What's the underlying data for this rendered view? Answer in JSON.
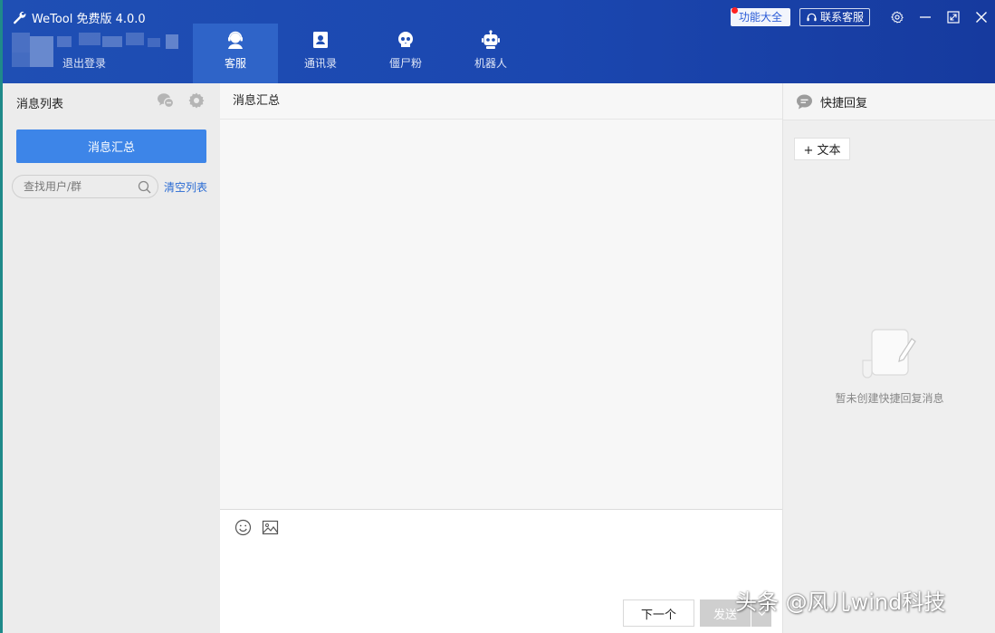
{
  "app": {
    "title": "WeTool 免费版 4.0.0",
    "logout_label": "退出登录"
  },
  "nav": {
    "items": [
      {
        "label": "客服",
        "icon": "customer-service-icon",
        "active": true
      },
      {
        "label": "通讯录",
        "icon": "contacts-icon",
        "active": false
      },
      {
        "label": "僵尸粉",
        "icon": "skull-icon",
        "active": false
      },
      {
        "label": "机器人",
        "icon": "robot-icon",
        "active": false
      }
    ]
  },
  "top_right": {
    "features_label": "功能大全",
    "support_label": "联系客服"
  },
  "left_panel": {
    "title": "消息列表",
    "summary_button": "消息汇总",
    "search_placeholder": "查找用户/群",
    "clear_list": "清空列表"
  },
  "middle_panel": {
    "title": "消息汇总",
    "next_button": "下一个",
    "send_button": "发送"
  },
  "right_panel": {
    "title": "快捷回复",
    "add_text_button": "+ 文本",
    "empty_text": "暂未创建快捷回复消息"
  },
  "watermark": "头条 @风儿wind科技",
  "colors": {
    "header": "#1f4fb4",
    "active_tab": "#2f64c8",
    "primary_button": "#3d85e8",
    "link": "#2a6bd3",
    "notification_dot": "#ff2222"
  }
}
